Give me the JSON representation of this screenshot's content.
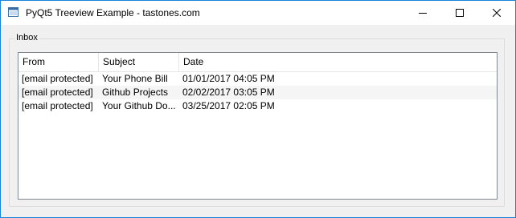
{
  "window": {
    "title": "PyQt5 Treeview Example - tastones.com",
    "controls": {
      "minimize": "minimize-icon",
      "maximize": "maximize-icon",
      "close": "close-icon"
    }
  },
  "groupbox": {
    "title": "Inbox"
  },
  "tree": {
    "columns": [
      "From",
      "Subject",
      "Date"
    ],
    "rows": [
      [
        "[email protected]",
        "Your Phone Bill",
        "01/01/2017 04:05 PM"
      ],
      [
        "[email protected]",
        "Github Projects",
        "02/02/2017 03:05 PM"
      ],
      [
        "[email protected]",
        "Your Github Do...",
        "03/25/2017 02:05 PM"
      ]
    ]
  },
  "colors": {
    "window_border": "#1883d7",
    "window_bg": "#f0f0f0",
    "alt_row": "#f5f5f5"
  }
}
